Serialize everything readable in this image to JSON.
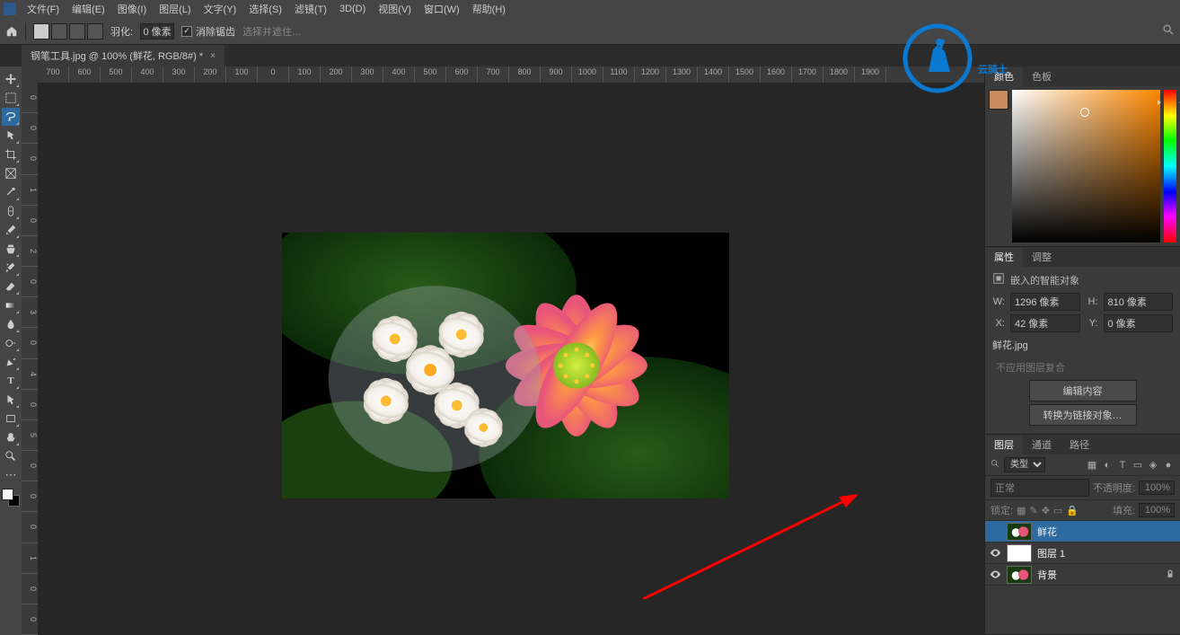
{
  "menu": {
    "items": [
      "文件(F)",
      "编辑(E)",
      "图像(I)",
      "图层(L)",
      "文字(Y)",
      "选择(S)",
      "滤镜(T)",
      "3D(D)",
      "视图(V)",
      "窗口(W)",
      "帮助(H)"
    ]
  },
  "options": {
    "feather_label": "羽化:",
    "feather_value": "0 像素",
    "antialias_label": "消除锯齿",
    "selectmove_label": "选择并遮住…"
  },
  "doc_tab": {
    "title": "钢笔工具.jpg @ 100% (鲜花, RGB/8#) *"
  },
  "ruler_h": [
    "700",
    "600",
    "500",
    "400",
    "300",
    "200",
    "100",
    "0",
    "100",
    "200",
    "300",
    "400",
    "500",
    "600",
    "700",
    "800",
    "900",
    "1000",
    "1100",
    "1200",
    "1300",
    "1400",
    "1500",
    "1600",
    "1700",
    "1800",
    "1900"
  ],
  "ruler_v": [
    "0",
    "0",
    "0",
    "1",
    "0",
    "2",
    "0",
    "3",
    "0",
    "4",
    "0",
    "5",
    "0",
    "0",
    "0",
    "1",
    "0",
    "0"
  ],
  "panels": {
    "color_tab": "颜色",
    "swatches_tab": "色板",
    "props_tab": "属性",
    "adjust_tab": "调整",
    "layers_tab": "图层",
    "channels_tab": "通道",
    "paths_tab": "路径"
  },
  "properties": {
    "header_icon_label": "嵌入的智能对象",
    "w_label": "W:",
    "w_value": "1296 像素",
    "h_label": "H:",
    "h_value": "810 像素",
    "x_label": "X:",
    "x_value": "42 像素",
    "y_label": "Y:",
    "y_value": "0 像素",
    "filename": "鲜花.jpg",
    "no_comp": "不应用图层复合",
    "edit_btn": "编辑内容",
    "convert_btn": "转换为链接对象…"
  },
  "layers": {
    "filter_label": "类型",
    "blend_mode": "正常",
    "opacity_label": "不透明度:",
    "opacity_value": "100%",
    "lock_label": "锁定:",
    "fill_label": "填充:",
    "fill_value": "100%",
    "items": [
      {
        "name": "鲜花",
        "visible": false,
        "selected": true,
        "smart": true
      },
      {
        "name": "图层 1",
        "visible": true,
        "selected": false,
        "smart": false
      },
      {
        "name": "背景",
        "visible": true,
        "selected": false,
        "locked": true
      }
    ]
  },
  "watermark_text": "云骑士"
}
